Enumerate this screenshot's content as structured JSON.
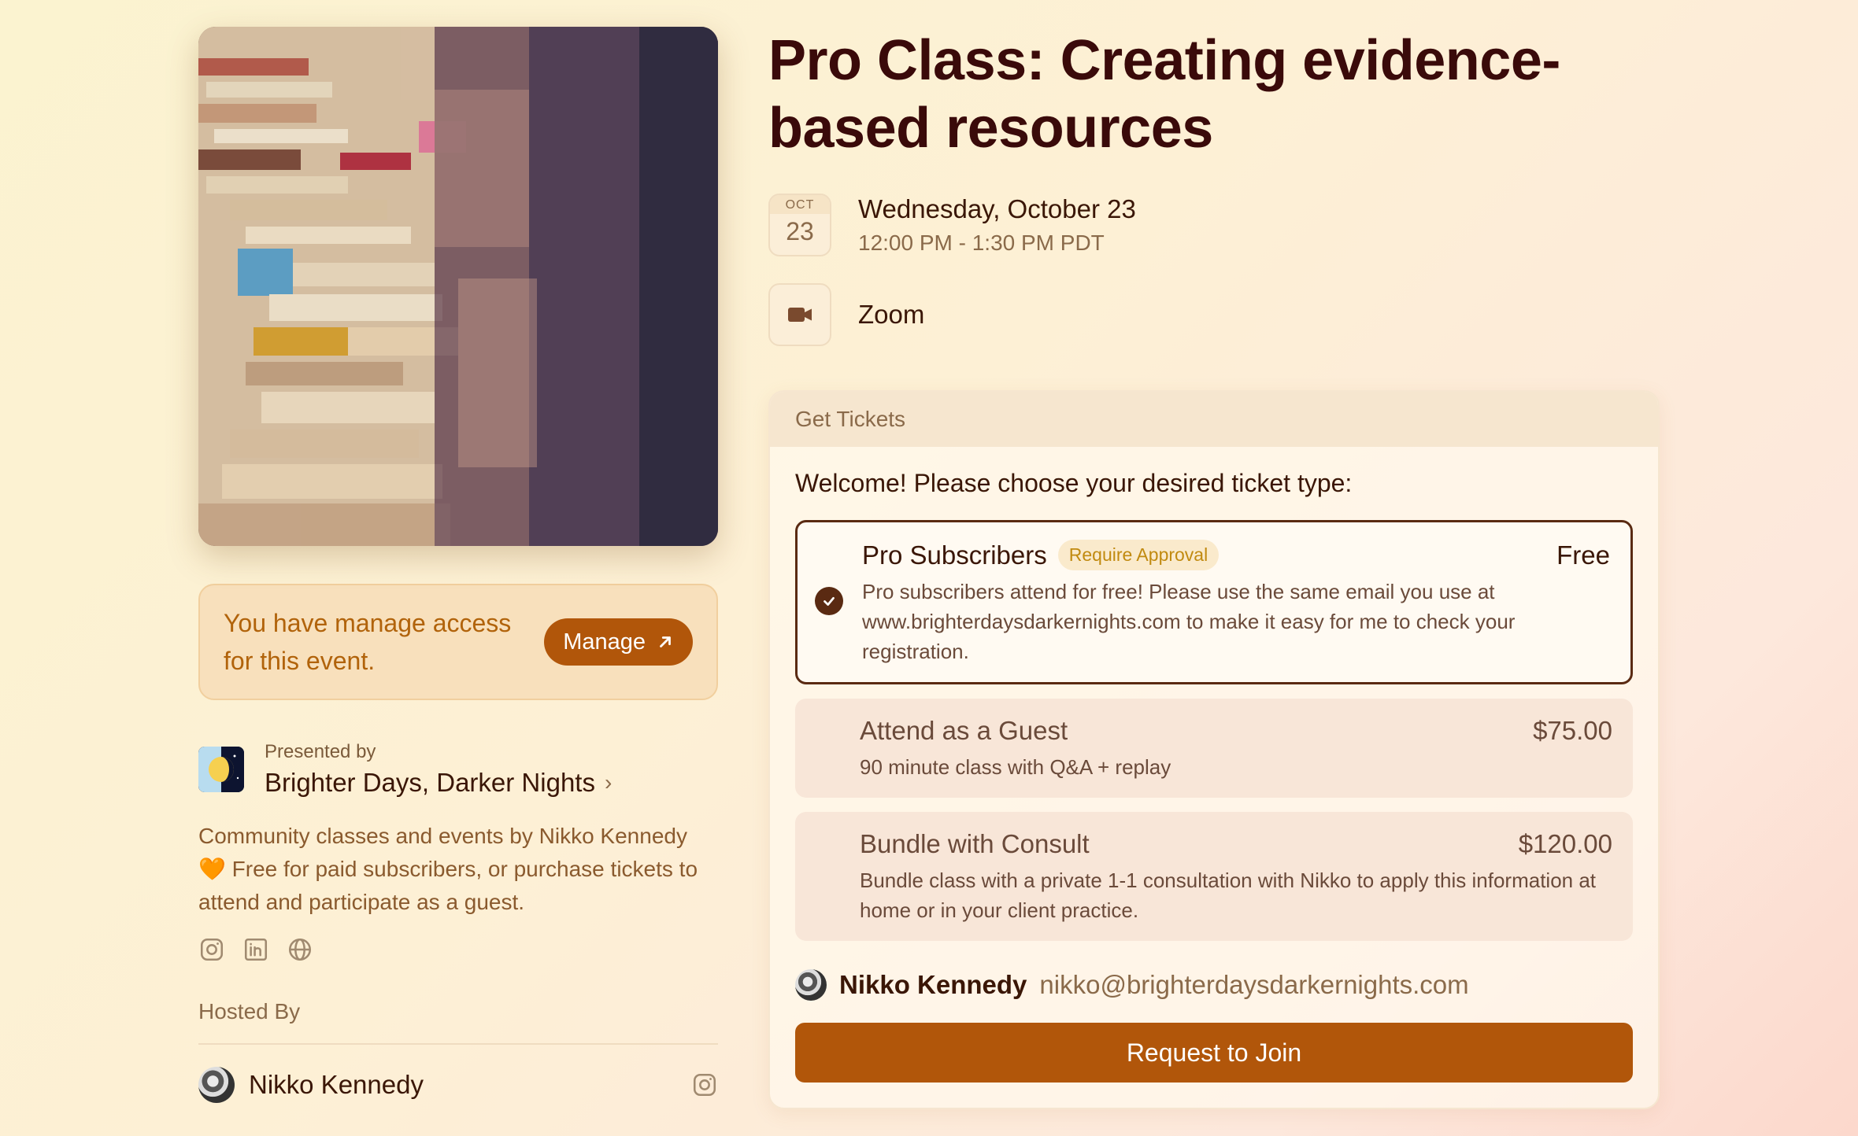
{
  "event": {
    "title": "Pro Class: Creating evidence-based resources",
    "calendar_month": "OCT",
    "calendar_day": "23",
    "date": "Wednesday, October 23",
    "time": "12:00 PM - 1:30 PM PDT",
    "location": "Zoom"
  },
  "manage": {
    "text": "You have manage access for this event.",
    "button_label": "Manage"
  },
  "presenter": {
    "presented_by_label": "Presented by",
    "name": "Brighter Days, Darker Nights",
    "description_part1": "Community classes and events by Nikko Kennedy",
    "description_part2": " Free for paid subscribers, or purchase tickets to attend and participate as a guest.",
    "heart": "🧡"
  },
  "hosted_by": {
    "label": "Hosted By",
    "host_name": "Nikko Kennedy"
  },
  "tickets": {
    "header": "Get Tickets",
    "welcome": "Welcome! Please choose your desired ticket type:",
    "options": [
      {
        "name": "Pro Subscribers",
        "badge": "Require Approval",
        "price": "Free",
        "description": "Pro subscribers attend for free! Please use the same email you use at www.brighterdaysdarkernights.com to make it easy for me to check your registration."
      },
      {
        "name": "Attend as a Guest",
        "price": "$75.00",
        "description": "90 minute class with Q&A + replay"
      },
      {
        "name": "Bundle with Consult",
        "price": "$120.00",
        "description": "Bundle class with a private 1-1 consultation with Nikko to apply this information at home or in your client practice."
      }
    ],
    "user_name": "Nikko Kennedy",
    "user_email": "nikko@brighterdaysdarkernights.com",
    "join_label": "Request to Join"
  },
  "colors": {
    "accent": "#b1560a",
    "title": "#3a0a0a",
    "badge_text": "#c18a10"
  },
  "icons": {
    "location": "video-camera-icon",
    "socials": [
      "instagram-icon",
      "linkedin-icon",
      "globe-icon"
    ]
  }
}
